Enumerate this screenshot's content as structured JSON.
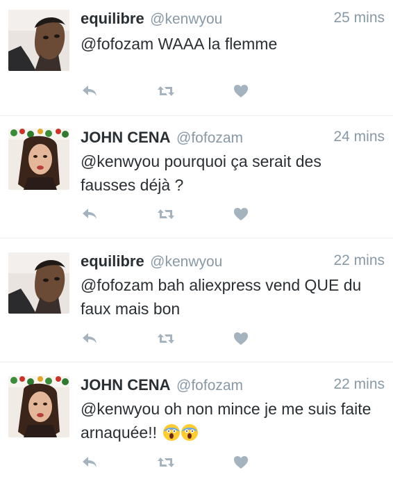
{
  "tweets": [
    {
      "author": "equilibre",
      "handle": "@kenwyou",
      "time": "25 mins",
      "text": "@fofozam WAAA la flemme",
      "emoji": "",
      "avatar_icon": "user-avatar-male"
    },
    {
      "author": "JOHN CENA",
      "handle": "@fofozam",
      "time": "24 mins",
      "text": "@kenwyou pourquoi ça serait des fausses déjà ?",
      "emoji": "",
      "avatar_icon": "user-avatar-female"
    },
    {
      "author": "equilibre",
      "handle": "@kenwyou",
      "time": "22 mins",
      "text": "@fofozam bah aliexpress vend QUE du faux mais bon",
      "emoji": "",
      "avatar_icon": "user-avatar-male"
    },
    {
      "author": "JOHN CENA",
      "handle": "@fofozam",
      "time": "22 mins",
      "text": "@kenwyou oh non mince je me suis faite arnaquée!!",
      "emoji": "😱😱",
      "avatar_icon": "user-avatar-female"
    }
  ],
  "colors": {
    "action_icon": "#a4b3be",
    "name": "#292f33",
    "secondary": "#8899a6",
    "divider": "#e6ecf0"
  },
  "icons": [
    "reply-icon",
    "retweet-icon",
    "like-icon"
  ]
}
